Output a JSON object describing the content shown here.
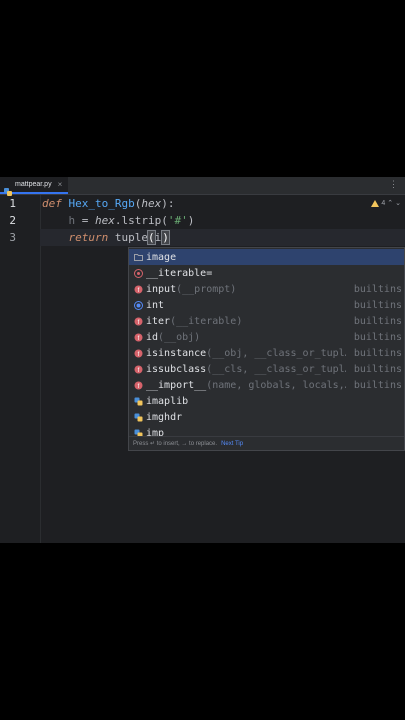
{
  "tab": {
    "filename": "mattpear.py"
  },
  "inspection": {
    "warnings": "4"
  },
  "lines": [
    {
      "num": "1",
      "kw": "def",
      "fn": "Hex_to_Rgb",
      "open": "(",
      "param": "hex",
      "close": "):"
    },
    {
      "num": "2",
      "var": "h",
      "eq": " = ",
      "obj": "hex",
      "call": ".lstrip(",
      "str": "'#'",
      "close": ")"
    },
    {
      "num": "3",
      "kw": "return",
      "fn": "tuple",
      "paren": "(",
      "typed": "i",
      "close": ")"
    }
  ],
  "completion": {
    "items": [
      {
        "label": "image",
        "sig": "",
        "source": "",
        "icon": "folder-icon"
      },
      {
        "label": "__iterable=",
        "sig": "",
        "source": "",
        "icon": "parameter-icon"
      },
      {
        "label": "input",
        "sig": "(__prompt)",
        "source": "builtins",
        "icon": "function-icon"
      },
      {
        "label": "int",
        "sig": "",
        "source": "builtins",
        "icon": "class-icon"
      },
      {
        "label": "iter",
        "sig": "(__iterable)",
        "source": "builtins",
        "icon": "function-icon"
      },
      {
        "label": "id",
        "sig": "(__obj)",
        "source": "builtins",
        "icon": "function-icon"
      },
      {
        "label": "isinstance",
        "sig": "(__obj, __class_or_tupl…",
        "source": "builtins",
        "icon": "function-icon"
      },
      {
        "label": "issubclass",
        "sig": "(__cls, __class_or_tupl…",
        "source": "builtins",
        "icon": "function-icon"
      },
      {
        "label": "__import__",
        "sig": "(name, globals, locals,…",
        "source": "builtins",
        "icon": "function-icon"
      },
      {
        "label": "imaplib",
        "sig": "",
        "source": "",
        "icon": "python-module-icon"
      },
      {
        "label": "imghdr",
        "sig": "",
        "source": "",
        "icon": "python-module-icon"
      },
      {
        "label": "imp",
        "sig": "",
        "source": "",
        "icon": "python-module-icon"
      }
    ],
    "footer_text": "Press ↵ to insert, → to replace.",
    "footer_tip": "Next Tip"
  }
}
